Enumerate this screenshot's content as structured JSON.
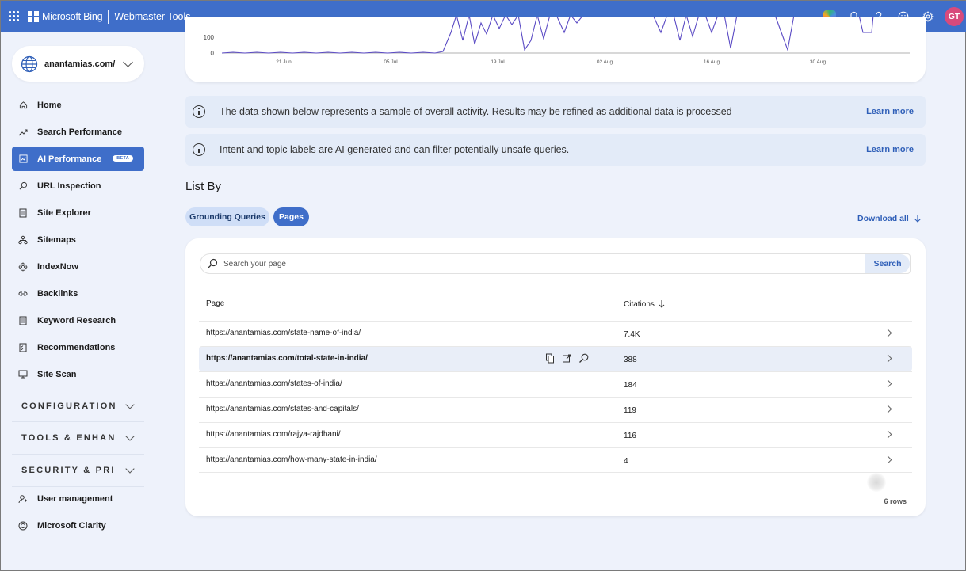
{
  "topbar": {
    "brand": "Microsoft Bing",
    "product": "Webmaster Tools",
    "avatar_initials": "GT",
    "accent_color": "#3f6ec9"
  },
  "sidebar": {
    "site": "anantamias.com/",
    "items": [
      {
        "label": "Home",
        "icon": "home-icon"
      },
      {
        "label": "Search Performance",
        "icon": "trend-icon"
      },
      {
        "label": "AI Performance",
        "icon": "ai-chart-icon",
        "badge": "BETA",
        "active": true
      },
      {
        "label": "URL Inspection",
        "icon": "search-icon"
      },
      {
        "label": "Site Explorer",
        "icon": "document-icon"
      },
      {
        "label": "Sitemaps",
        "icon": "sitemap-icon"
      },
      {
        "label": "IndexNow",
        "icon": "gear-icon"
      },
      {
        "label": "Backlinks",
        "icon": "link-icon"
      },
      {
        "label": "Keyword Research",
        "icon": "document-icon"
      },
      {
        "label": "Recommendations",
        "icon": "checklist-icon"
      },
      {
        "label": "Site Scan",
        "icon": "scan-icon"
      }
    ],
    "sections": [
      "CONFIGURATION",
      "TOOLS & ENHANCEMENTS",
      "SECURITY & PRIVACY"
    ],
    "bottom_items": [
      {
        "label": "User management",
        "icon": "user-icon"
      },
      {
        "label": "Microsoft Clarity",
        "icon": "clarity-icon"
      }
    ]
  },
  "chart": {
    "y_ticks": [
      "100",
      "0"
    ],
    "x_ticks": [
      "21 Jun",
      "05 Jul",
      "19 Jul",
      "02 Aug",
      "16 Aug",
      "30 Aug"
    ],
    "line_color": "#5b4bc4"
  },
  "notices": [
    {
      "text": "The data shown below represents a sample of overall activity. Results may be refined as additional data is processed",
      "link": "Learn more"
    },
    {
      "text": "Intent and topic labels are AI generated and can filter potentially unsafe queries.",
      "link": "Learn more"
    }
  ],
  "list_by": {
    "title": "List By",
    "tabs": [
      "Grounding Queries",
      "Pages"
    ],
    "active_tab": "Pages",
    "download": "Download all"
  },
  "table": {
    "search_placeholder": "Search your page",
    "search_button": "Search",
    "columns": [
      "Page",
      "Citations"
    ],
    "rows": [
      {
        "url": "https://anantamias.com/state-name-of-india/",
        "citations": "7.4K"
      },
      {
        "url": "https://anantamias.com/total-state-in-india/",
        "citations": "388"
      },
      {
        "url": "https://anantamias.com/states-of-india/",
        "citations": "184"
      },
      {
        "url": "https://anantamias.com/states-and-capitals/",
        "citations": "119"
      },
      {
        "url": "https://anantamias.com/rajya-rajdhani/",
        "citations": "116"
      },
      {
        "url": "https://anantamias.com/how-many-state-in-india/",
        "citations": "4"
      }
    ],
    "row_count": "6 rows"
  }
}
